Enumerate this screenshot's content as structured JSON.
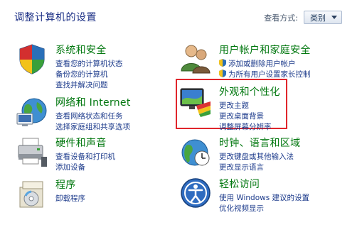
{
  "header": {
    "title": "调整计算机的设置",
    "view_by_label": "查看方式:",
    "view_by_value": "类别"
  },
  "categories": {
    "system": {
      "title": "系统和安全",
      "links": [
        "查看您的计算机状态",
        "备份您的计算机",
        "查找并解决问题"
      ]
    },
    "network": {
      "title": "网络和 Internet",
      "links": [
        "查看网络状态和任务",
        "选择家庭组和共享选项"
      ]
    },
    "hardware": {
      "title": "硬件和声音",
      "links": [
        "查看设备和打印机",
        "添加设备"
      ]
    },
    "programs": {
      "title": "程序",
      "links": [
        "卸载程序"
      ]
    },
    "accounts": {
      "title": "用户帐户和家庭安全",
      "links": [
        "添加或删除用户帐户",
        "为所有用户设置家长控制"
      ]
    },
    "appearance": {
      "title": "外观和个性化",
      "links": [
        "更改主题",
        "更改桌面背景",
        "调整屏幕分辨率"
      ]
    },
    "clock": {
      "title": "时钟、语言和区域",
      "links": [
        "更改键盘或其他输入法",
        "更改显示语言"
      ]
    },
    "ease": {
      "title": "轻松访问",
      "links": [
        "使用 Windows 建议的设置",
        "优化视频显示"
      ]
    }
  },
  "colors": {
    "category_title": "#00770e",
    "link": "#1e3c8c",
    "highlight_border": "#e0262c"
  }
}
